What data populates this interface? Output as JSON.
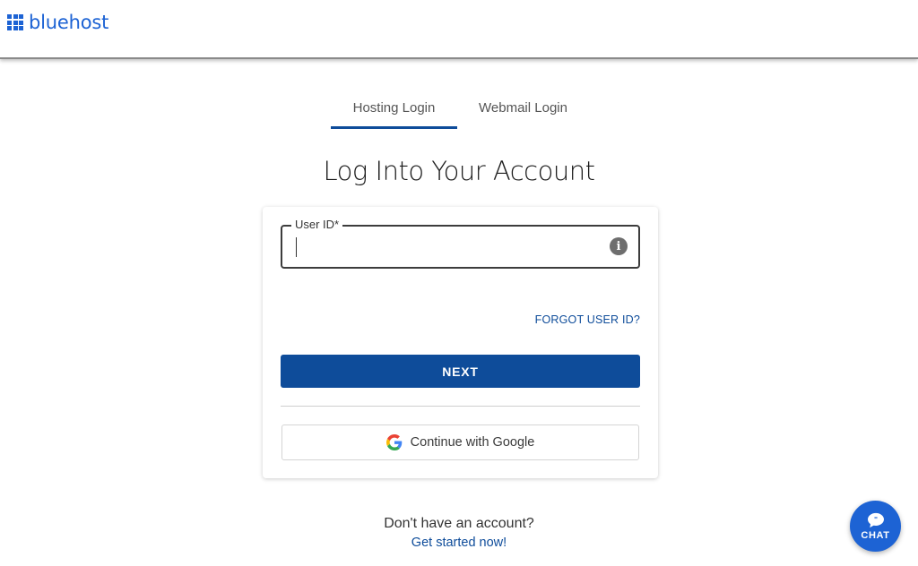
{
  "header": {
    "logo_text": "bluehost",
    "brand_color": "#1d63d4"
  },
  "tabs": [
    {
      "label": "Hosting Login",
      "active": true
    },
    {
      "label": "Webmail Login",
      "active": false
    }
  ],
  "page_title": "Log Into Your Account",
  "form": {
    "user_id_label": "User ID*",
    "user_id_value": "",
    "info_icon": "info-icon",
    "forgot_label": "FORGOT USER ID?",
    "next_label": "NEXT",
    "google_label": "Continue with Google",
    "primary_color": "#0e4c9a"
  },
  "footer": {
    "question": "Don't have an account?",
    "link": "Get started now!"
  },
  "chat": {
    "label": "CHAT"
  }
}
